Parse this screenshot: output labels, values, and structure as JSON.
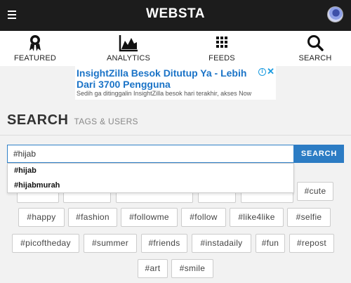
{
  "header": {
    "brand": "WEBSTA"
  },
  "nav": [
    {
      "label": "FEATURED",
      "icon": "award-ribbon-icon"
    },
    {
      "label": "ANALYTICS",
      "icon": "area-chart-icon"
    },
    {
      "label": "FEEDS",
      "icon": "grid-icon"
    },
    {
      "label": "SEARCH",
      "icon": "search-icon"
    }
  ],
  "ad": {
    "title": "InsightZilla Besok Ditutup Ya - Lebih Dari 3700 Pengguna",
    "description": "Sedih ga ditinggalin InsightZilla besok hari terakhir, akses Now"
  },
  "search": {
    "title": "SEARCH",
    "subtitle": "TAGS & USERS",
    "input_value": "#hijab",
    "button_label": "SEARCH",
    "suggestions": [
      "#hijab",
      "#hijabmurah"
    ]
  },
  "tags": [
    "#cute",
    "#happy",
    "#fashion",
    "#followme",
    "#follow",
    "#like4like",
    "#selfie",
    "#picoftheday",
    "#summer",
    "#friends",
    "#instadaily",
    "#fun",
    "#repost",
    "#art",
    "#smile"
  ],
  "colors": {
    "accent": "#2c7cc4",
    "topbar": "#1c1c1c",
    "ad_link": "#1a73c7"
  }
}
